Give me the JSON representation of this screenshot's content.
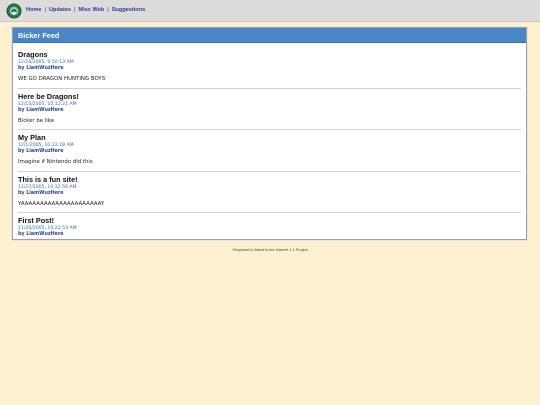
{
  "nav": {
    "items": [
      {
        "label": "Home"
      },
      {
        "label": "Updates"
      },
      {
        "label": "Misc Web"
      },
      {
        "label": "Suggestions"
      }
    ],
    "separator": "|"
  },
  "feed": {
    "title": "Bicker Feed",
    "posts": [
      {
        "title": "Dragons",
        "date": "12/16/2005, 9:50:13 AM",
        "author": "by LiamWuzHere",
        "body": "WE GO DRAGON HUNTING BOYS"
      },
      {
        "title": "Here be Dragons!",
        "date": "12/15/2005, 10:12:21 AM",
        "author": "by LiamWuzHere",
        "body": "Bicker be like"
      },
      {
        "title": "My Plan",
        "date": "12/1/2005, 10:22:28 AM",
        "author": "by LiamWuzHere",
        "body": "Imagine if Nintendo did this"
      },
      {
        "title": "This is a fun site!",
        "date": "11/27/2005, 10:32:56 AM",
        "author": "by LiamWuzHere",
        "body": "YAAAAAAAAAAAAAAAAAAAAAY"
      },
      {
        "title": "First Post!",
        "date": "11/20/2005, 10:22:53 AM",
        "author": "by LiamWuzHere",
        "body": ""
      }
    ]
  },
  "footer": {
    "text": "Simplonet is linked to the Internet 1.1 Project"
  }
}
